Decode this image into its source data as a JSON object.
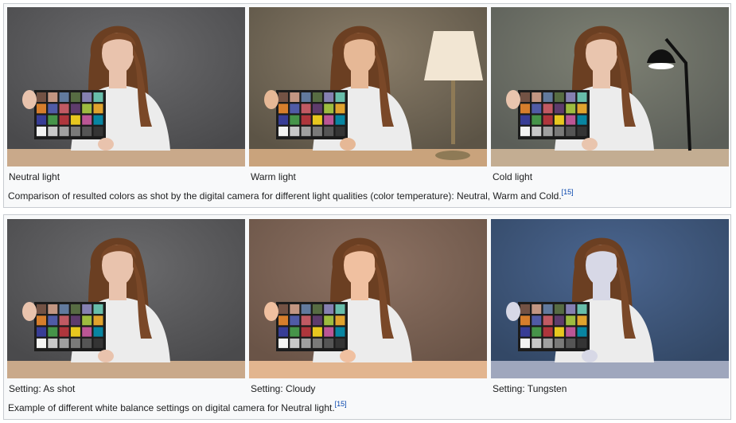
{
  "galleries": [
    {
      "items": [
        {
          "caption": "Neutral light",
          "icon": "photo-neutral-light",
          "bg": "#4a4a4c",
          "wall_light": "#6b6b6d",
          "table": "#c9a98a",
          "skin": "#e9c3ad",
          "lamp": "none"
        },
        {
          "caption": "Warm light",
          "icon": "photo-warm-light",
          "bg": "#5c5446",
          "wall_light": "#8a7d69",
          "table": "#c9a37c",
          "skin": "#e6b896",
          "lamp": "table"
        },
        {
          "caption": "Cold light",
          "icon": "photo-cold-light",
          "bg": "#5b5e58",
          "wall_light": "#7e8174",
          "table": "#c3ad92",
          "skin": "#e9c5ae",
          "lamp": "desk"
        }
      ],
      "caption_text": "Comparison of resulted colors as shot by the digital camera for different light qualities (color temperature): Neutral, Warm and Cold.",
      "ref": "[15]"
    },
    {
      "items": [
        {
          "caption": "Setting: As shot",
          "icon": "photo-as-shot",
          "bg": "#4a4a4c",
          "wall_light": "#6b6b6d",
          "table": "#c9a98a",
          "skin": "#e9c3ad",
          "lamp": "none"
        },
        {
          "caption": "Setting: Cloudy",
          "icon": "photo-cloudy",
          "bg": "#6a5447",
          "wall_light": "#8d7263",
          "table": "#e2b58f",
          "skin": "#f0c0a0",
          "lamp": "none"
        },
        {
          "caption": "Setting: Tungsten",
          "icon": "photo-tungsten",
          "bg": "#334866",
          "wall_light": "#4b6690",
          "table": "#9fa7bd",
          "skin": "#d7d8e6",
          "lamp": "none"
        }
      ],
      "caption_text": "Example of different white balance settings on digital camera for Neutral light.",
      "ref": "[15]"
    }
  ],
  "checker_colors": [
    "#735244",
    "#c29682",
    "#627a9d",
    "#576c43",
    "#8580b1",
    "#67bdaa",
    "#d67e2c",
    "#505ba6",
    "#c15a63",
    "#5e3c6c",
    "#9dbc40",
    "#e0a32e",
    "#383d96",
    "#469449",
    "#af363c",
    "#e7c71f",
    "#bb5695",
    "#0885a1",
    "#f3f3f2",
    "#c8c8c8",
    "#a0a0a0",
    "#7a7a79",
    "#555555",
    "#343434"
  ]
}
